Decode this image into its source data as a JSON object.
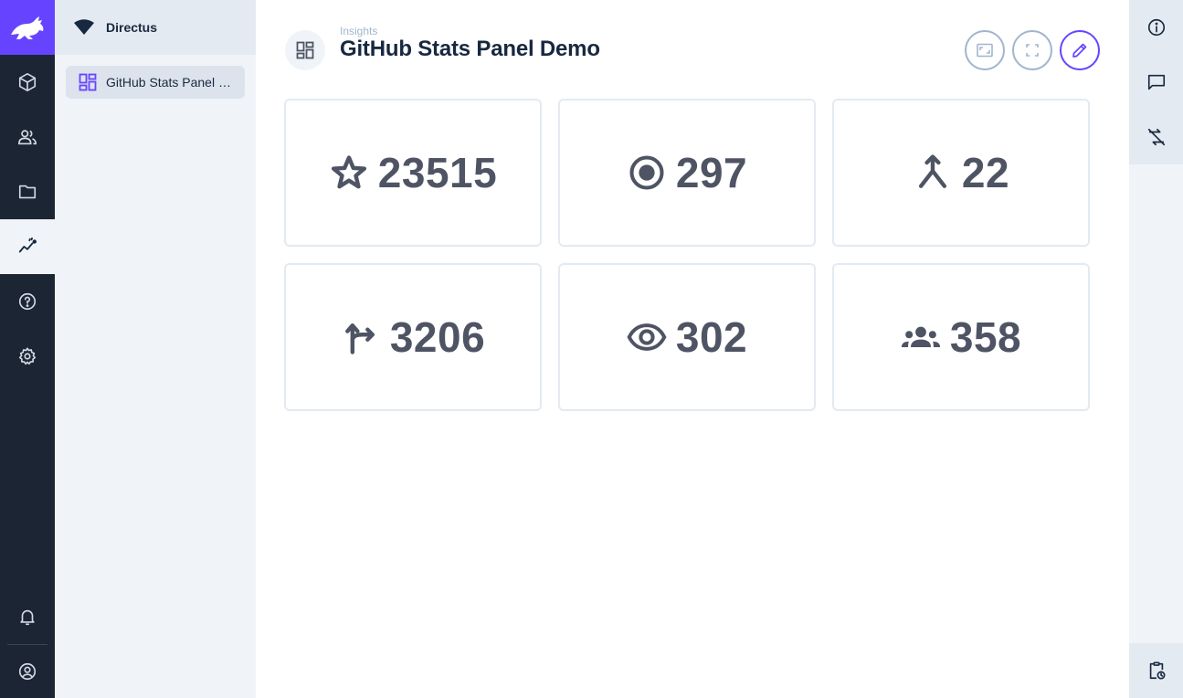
{
  "app": {
    "project_name": "Directus",
    "brand_color": "#6644ff"
  },
  "module_bar": {
    "items": [
      {
        "name": "content",
        "icon": "box-icon"
      },
      {
        "name": "users",
        "icon": "people-icon"
      },
      {
        "name": "files",
        "icon": "folder-icon"
      },
      {
        "name": "insights",
        "icon": "insights-icon",
        "active": true
      },
      {
        "name": "help",
        "icon": "help-icon"
      },
      {
        "name": "settings",
        "icon": "gear-icon"
      },
      {
        "name": "notifications",
        "icon": "bell-icon"
      },
      {
        "name": "user",
        "icon": "account-icon"
      }
    ]
  },
  "nav": {
    "items": [
      {
        "label": "GitHub Stats Panel Demo",
        "icon": "dashboard-icon",
        "active": true
      }
    ]
  },
  "header": {
    "breadcrumb": "Insights",
    "title": "GitHub Stats Panel Demo",
    "icon": "dashboard-icon",
    "actions": [
      {
        "name": "fit-to-screen",
        "icon": "fit-screen-icon"
      },
      {
        "name": "fullscreen",
        "icon": "fullscreen-icon"
      },
      {
        "name": "edit",
        "icon": "pencil-icon",
        "primary": true
      }
    ]
  },
  "panels": [
    {
      "icon": "star-icon",
      "value": "23515"
    },
    {
      "icon": "issue-icon",
      "value": "297"
    },
    {
      "icon": "merge-icon",
      "value": "22"
    },
    {
      "icon": "fork-icon",
      "value": "3206"
    },
    {
      "icon": "eye-icon",
      "value": "302"
    },
    {
      "icon": "group-icon",
      "value": "358"
    }
  ],
  "sidebar": {
    "items": [
      {
        "name": "info",
        "icon": "info-icon"
      },
      {
        "name": "comments",
        "icon": "comment-icon"
      },
      {
        "name": "revisions",
        "icon": "sync-disabled-icon"
      },
      {
        "name": "activity",
        "icon": "clipboard-clock-icon"
      }
    ]
  }
}
